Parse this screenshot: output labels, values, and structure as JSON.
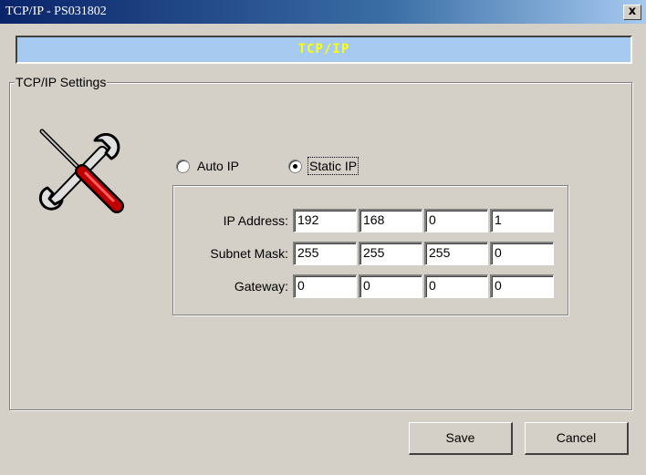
{
  "window": {
    "title": "TCP/IP - PS031802",
    "close_label": "x"
  },
  "banner": {
    "title": "TCP/IP"
  },
  "group": {
    "legend": "TCP/IP Settings"
  },
  "mode": {
    "auto_label": "Auto IP",
    "static_label": "Static IP",
    "selected": "static"
  },
  "fields": {
    "ip_label": "IP Address:",
    "subnet_label": "Subnet Mask:",
    "gateway_label": "Gateway:",
    "ip": [
      "192",
      "168",
      "0",
      "1"
    ],
    "subnet": [
      "255",
      "255",
      "255",
      "0"
    ],
    "gateway": [
      "0",
      "0",
      "0",
      "0"
    ]
  },
  "buttons": {
    "save": "Save",
    "cancel": "Cancel"
  },
  "icons": {
    "settings": "tools-icon"
  },
  "colors": {
    "banner_bg": "#a6caf0",
    "banner_text": "#ffff00",
    "title_bar": "#0a246a"
  }
}
